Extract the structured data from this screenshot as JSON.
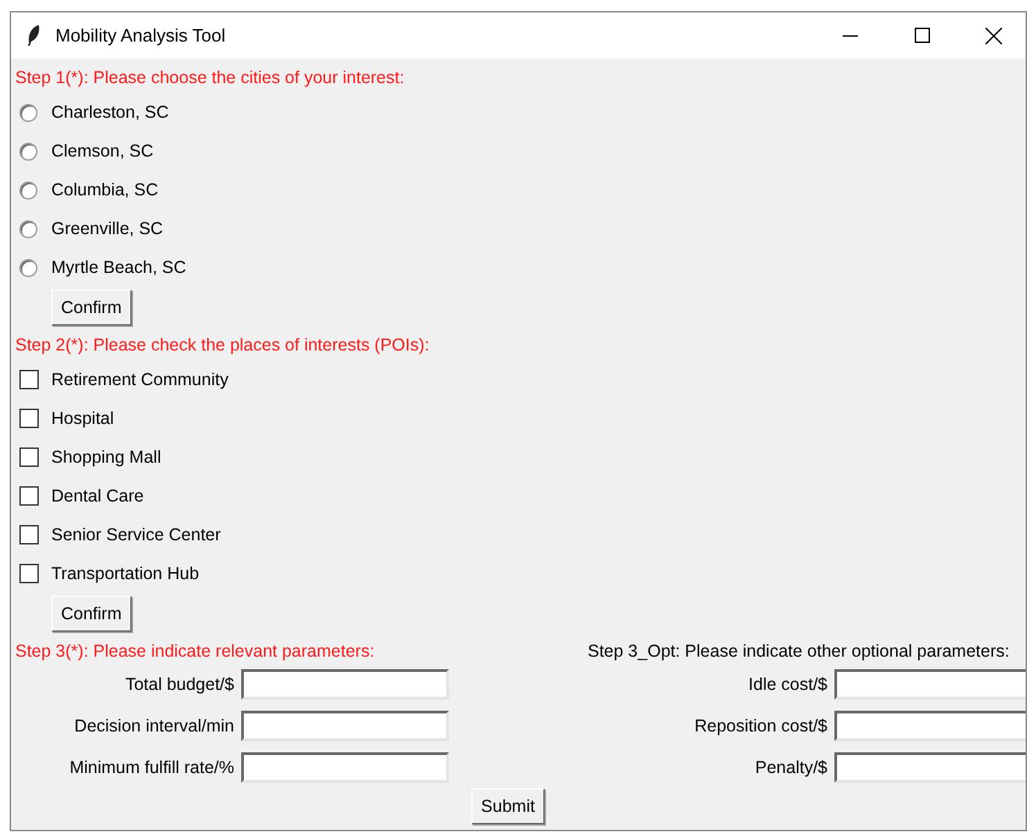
{
  "window": {
    "title": "Mobility Analysis Tool"
  },
  "step1": {
    "heading": "Step 1(*): Please choose the cities of your interest:",
    "cities": [
      {
        "label": "Charleston, SC",
        "selected": false
      },
      {
        "label": "Clemson, SC",
        "selected": false
      },
      {
        "label": "Columbia, SC",
        "selected": false
      },
      {
        "label": "Greenville, SC",
        "selected": false
      },
      {
        "label": "Myrtle Beach, SC",
        "selected": false
      }
    ],
    "button": "Confirm"
  },
  "step2": {
    "heading": "Step 2(*): Please check the places of interests (POIs):",
    "places": [
      {
        "label": "Retirement Community",
        "checked": false
      },
      {
        "label": "Hospital",
        "checked": false
      },
      {
        "label": "Shopping Mall",
        "checked": false
      },
      {
        "label": "Dental Care",
        "checked": false
      },
      {
        "label": "Senior Service Center",
        "checked": false
      },
      {
        "label": "Transportation Hub",
        "checked": false
      }
    ],
    "button": "Confirm"
  },
  "step3": {
    "heading": "Step 3(*): Please indicate relevant parameters:",
    "fields": [
      {
        "label": "Total budget/$"
      },
      {
        "label": "Decision interval/min"
      },
      {
        "label": "Minimum fulfill rate/%"
      }
    ]
  },
  "step3_opt": {
    "heading": "Step 3_Opt: Please indicate other optional parameters:",
    "fields": [
      {
        "label": "Idle cost/$"
      },
      {
        "label": "Reposition cost/$"
      },
      {
        "label": "Penalty/$"
      }
    ]
  },
  "submit": "Submit"
}
